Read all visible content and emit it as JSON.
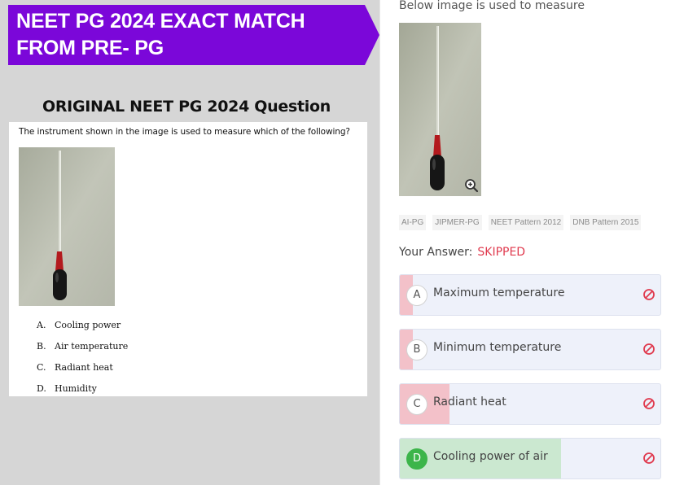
{
  "banner": {
    "text": "NEET PG 2024 EXACT MATCH FROM PRE- PG"
  },
  "original": {
    "heading": "ORIGINAL NEET PG 2024 Question",
    "question": "The instrument shown in the image is used to measure which of the following?",
    "options": [
      {
        "letter": "A.",
        "text": "Cooling power"
      },
      {
        "letter": "B.",
        "text": "Air temperature"
      },
      {
        "letter": "C.",
        "text": "Radiant heat"
      },
      {
        "letter": "D.",
        "text": "Humidity"
      }
    ]
  },
  "panel": {
    "caption": "Below image is used to measure",
    "zoom_icon": "zoom-in-icon",
    "tags": [
      "AI-PG",
      "JIPMER-PG",
      "NEET Pattern 2012",
      "DNB Pattern 2015"
    ],
    "answer_label": "Your Answer:",
    "answer_value": "SKIPPED",
    "choices": [
      {
        "letter": "A",
        "text": "Maximum temperature",
        "share": 0.05,
        "fill_color": "#f3c1c9",
        "correct": false
      },
      {
        "letter": "B",
        "text": "Minimum temperature",
        "share": 0.05,
        "fill_color": "#f3c1c9",
        "correct": false
      },
      {
        "letter": "C",
        "text": "Radiant heat",
        "share": 0.19,
        "fill_color": "#f3c1c9",
        "correct": false
      },
      {
        "letter": "D",
        "text": "Cooling power of air",
        "share": 0.62,
        "fill_color": "#cbe8d0",
        "correct": true
      }
    ],
    "colors": {
      "accent": "#7b07d9",
      "skipped": "#e03a4e",
      "correct": "#3cb54a",
      "wrong_fill": "#f3c1c9",
      "correct_fill": "#cbe8d0"
    }
  }
}
